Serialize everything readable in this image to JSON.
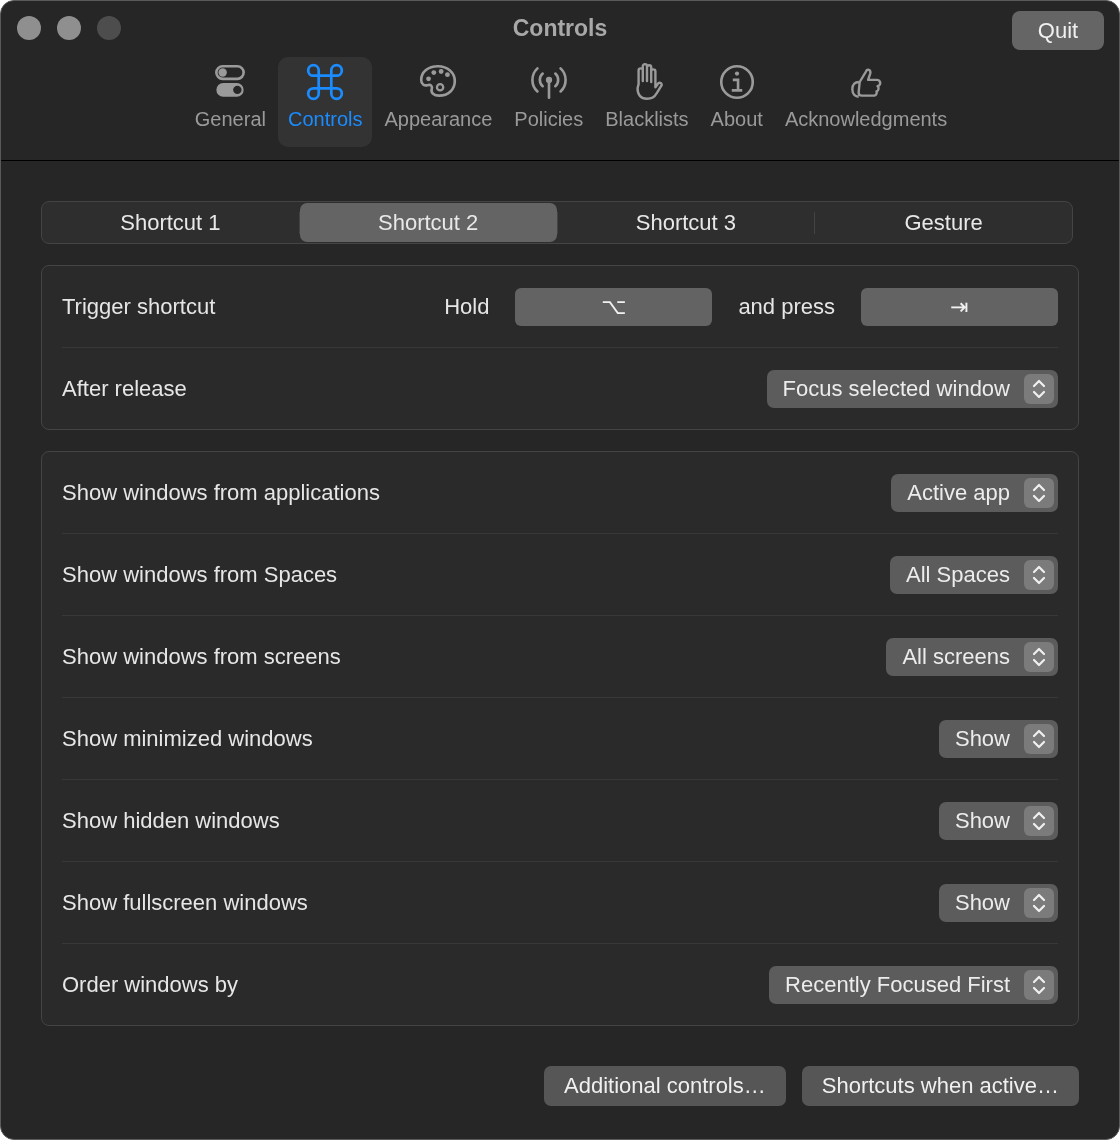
{
  "window": {
    "title": "Controls"
  },
  "quit_button": "Quit",
  "toolbar": [
    {
      "label": "General",
      "kind": "toggles",
      "selected": false
    },
    {
      "label": "Controls",
      "kind": "command",
      "selected": true
    },
    {
      "label": "Appearance",
      "kind": "palette",
      "selected": false
    },
    {
      "label": "Policies",
      "kind": "antenna",
      "selected": false
    },
    {
      "label": "Blacklists",
      "kind": "hand",
      "selected": false
    },
    {
      "label": "About",
      "kind": "info",
      "selected": false
    },
    {
      "label": "Acknowledgments",
      "kind": "thumb",
      "selected": false
    }
  ],
  "segments": [
    {
      "label": "Shortcut 1",
      "selected": false
    },
    {
      "label": "Shortcut 2",
      "selected": true
    },
    {
      "label": "Shortcut 3",
      "selected": false
    },
    {
      "label": "Gesture",
      "selected": false
    }
  ],
  "trigger": {
    "label": "Trigger shortcut",
    "hold_label": "Hold",
    "hold_key": "⌥",
    "press_label": "and press",
    "press_key": "⇥"
  },
  "after_release": {
    "label": "After release",
    "value": "Focus selected window"
  },
  "settings": [
    {
      "label": "Show windows from applications",
      "value": "Active app"
    },
    {
      "label": "Show windows from Spaces",
      "value": "All Spaces"
    },
    {
      "label": "Show windows from screens",
      "value": "All screens"
    },
    {
      "label": "Show minimized windows",
      "value": "Show"
    },
    {
      "label": "Show hidden windows",
      "value": "Show"
    },
    {
      "label": "Show fullscreen windows",
      "value": "Show"
    },
    {
      "label": "Order windows by",
      "value": "Recently Focused First"
    }
  ],
  "buttons": [
    "Additional controls…",
    "Shortcuts when active…"
  ]
}
